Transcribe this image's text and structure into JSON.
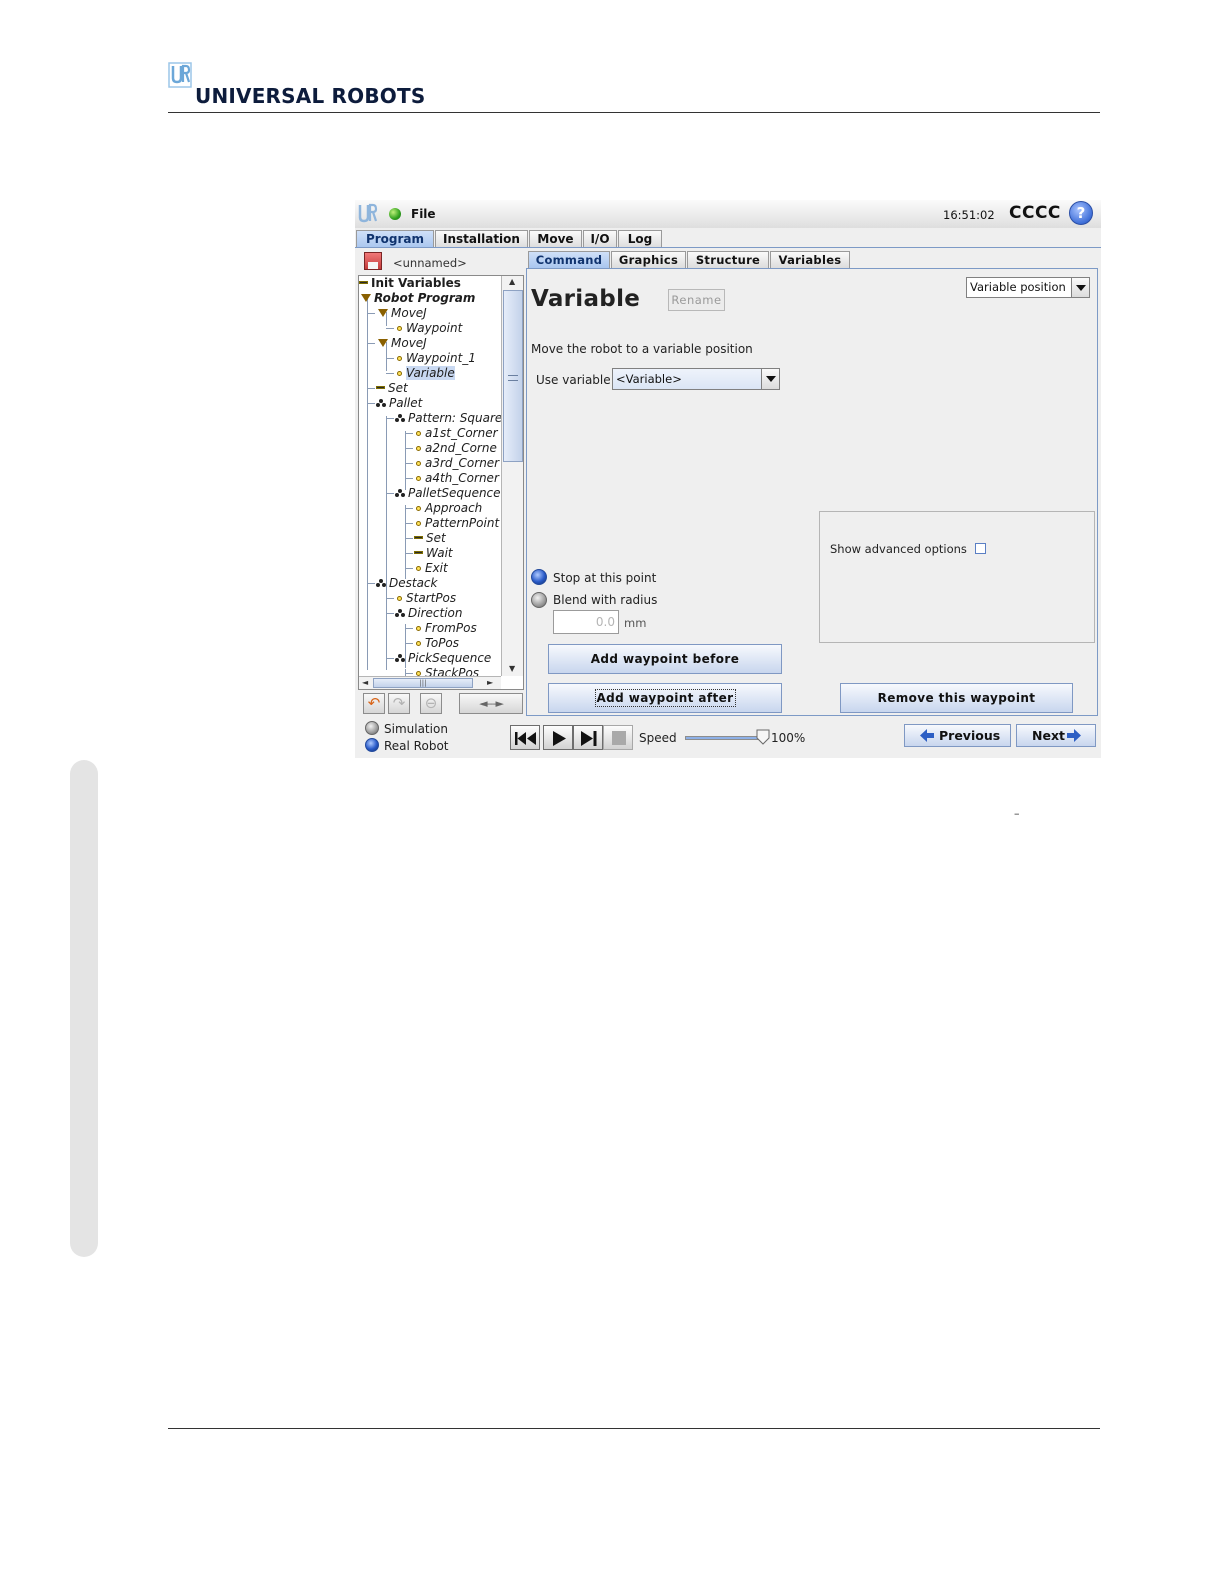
{
  "header": {
    "brand": "UNIVERSAL ROBOTS"
  },
  "app": {
    "menu_file": "File",
    "clock": "16:51:02",
    "robot_name": "CCCC",
    "help": "?",
    "main_tabs": [
      "Program",
      "Installation",
      "Move",
      "I/O",
      "Log"
    ],
    "program_name": "<unnamed>"
  },
  "tree": {
    "items": [
      {
        "label": "Init Variables"
      },
      {
        "label": "Robot Program"
      },
      {
        "label": "MoveJ"
      },
      {
        "label": "Waypoint"
      },
      {
        "label": "MoveJ"
      },
      {
        "label": "Waypoint_1"
      },
      {
        "label": "Variable"
      },
      {
        "label": "Set"
      },
      {
        "label": "Pallet"
      },
      {
        "label": "Pattern: Square"
      },
      {
        "label": "a1st_Corner"
      },
      {
        "label": "a2nd_Corne"
      },
      {
        "label": "a3rd_Corner"
      },
      {
        "label": "a4th_Corner"
      },
      {
        "label": "PalletSequence"
      },
      {
        "label": "Approach"
      },
      {
        "label": "PatternPoint"
      },
      {
        "label": "Set"
      },
      {
        "label": "Wait"
      },
      {
        "label": "Exit"
      },
      {
        "label": "Destack"
      },
      {
        "label": "StartPos"
      },
      {
        "label": "Direction"
      },
      {
        "label": "FromPos"
      },
      {
        "label": "ToPos"
      },
      {
        "label": "PickSequence"
      },
      {
        "label": "StackPos"
      }
    ],
    "hscroll_grip": "|||",
    "nav_arrows": "◄---►"
  },
  "panel": {
    "sub_tabs": [
      "Command",
      "Graphics",
      "Structure",
      "Variables"
    ],
    "title": "Variable",
    "rename": "Rename",
    "kind_selected": "Variable position",
    "description": "Move the robot to a variable position",
    "use_variable_label": "Use variable",
    "use_variable_value": "<Variable>",
    "stop_label": "Stop at this point",
    "blend_label": "Blend with radius",
    "radius_value": "0.0",
    "radius_unit": "mm",
    "advanced_label": "Show advanced options",
    "add_before": "Add waypoint before",
    "add_after": "Add waypoint after",
    "remove": "Remove this waypoint"
  },
  "bottom": {
    "simulation": "Simulation",
    "real_robot": "Real Robot",
    "speed_label": "Speed",
    "speed_value": "100%",
    "speed_fraction": 1.0,
    "previous": "Previous",
    "next": "Next"
  },
  "page_mark": "–"
}
